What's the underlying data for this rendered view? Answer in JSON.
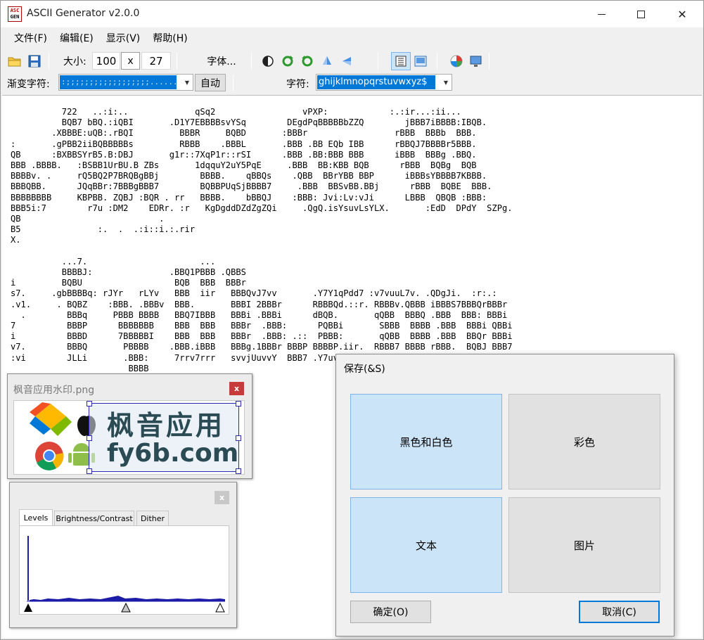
{
  "window": {
    "title": "ASCII Generator v2.0.0",
    "logo_line1": "ASC",
    "logo_line2": "GEN",
    "minimize": "–",
    "maximize": "□",
    "close": "✕"
  },
  "menu": [
    "文件(F)",
    "编辑(E)",
    "显示(V)",
    "帮助(H)"
  ],
  "toolbar": {
    "size_label": "大小:",
    "width": "100",
    "x_label": "x",
    "height": "27",
    "font_button": "字体...",
    "icons": [
      "open-folder-icon",
      "save-disk-icon",
      "invert-icon",
      "rotate-clockwise-icon",
      "rotate-counterclockwise-icon",
      "flip-vertical-icon",
      "flip-horizontal-icon",
      "text-view-icon",
      "image-view-icon",
      "color-palette-icon",
      "preview-monitor-icon"
    ]
  },
  "row2": {
    "ramp_label": "渐变字符:",
    "ramp_value": ":;;;;;;;;;;;;;;;;;;.............",
    "auto_button": "自动",
    "chars_label": "字符:",
    "chars_value": "ghijklmnopqrstuvwxyz$"
  },
  "ascii": "          722   ..:i:..             qSq2                 vPXP:            :.:ir...:ii...\n          BQB7 bBQ.:iQBI       .D1Y7EBBBBsvYSq        DEgdPqBBBBBbZZQ        jBBB7iBBBB:IBQB.\n        .XBBBE:uQB:.rBQI         BBBR     BQBD       :BBBr                 rBBB  BBBb  BBB.\n:       .gPBB2iiBQBBBBBs         RBBB    .BBBL       .BBB .BB EQb IBB      rBBQJ7BBBBr5BBB.\nQB      :BXBBSYrB5.B:DBJ       g1r::7XqP1r::rSI      .BBB .BB:BBB BBB      iBBB  BBBg .BBQ.\nBBB .BBBB.   :BSBB1UrBU.B ZBs       1dqquY2uY5PqE     .BBB  BB:KBB BQB      rBBB  BQBg  BQB\nBBBBv. .     rQ5BQ2P7BRQBgBBj        BBBB.    qBBQs    .QBB  BBrYBB BBP      iBBBsYBBBB7KBBB.\nBBBQBB.      JQqBBr:7BBBgBBB7        BQBBPUqSjBBBB7     .BBB  BBSvBB.BBj      rBBB  BQBE  BBB.\nBBBBBBBB     KBPBB. ZQBJ :BQR . rr   BBBB.    bBBQJ    :BBB: Jvi:Lv:vJi      LBBB  QBQB :BBB:\nBBB5i:7        r7u :DM2    EDRr. :r   KgDgddDZdZgZQi     .QgQ.isYsuvLsYLX.       :EdD  DPdY  SZPg.\nQB                           .\nB5               :.  .  .:i::i.:.rir\nX.\n\n          ...7.                      ...\n          BBBBJ:               .BBQ1PBBB .QBBS\ni         BQBU                  BQB  BBB  BBBr\ns7.     .gbBBBBq: rJYr   rLYv   BBB  iir   BBBQvJ7vv       .Y7Y1qPdd7 :v7vuuL7v. .QDgJi.  :r:.:\n.v1.     . BQBZ    :BBB. .BBBv  BBB.       BBBI 2BBBr      RBBBQd.::r. RBBBv.QBBB iBBBS7BBBQrBBBr\n  .        BBBq     PBBB BBBB   BBQ7IBBB   BBBi .BBBi      dBQB.       qQBB  BBBQ .BBB  BBB: BBBi\n7          BBBP      BBBBBBB    BBB  BBB   BBBr  .BBB:      PQBBi       SBBB  BBBB .BBB  BBBi QBBi\ni          BBBD      7BBBBBI    BBB  BBB   BBBr  .BBB: .::  PBBB:       qQBB  BBBB .BBB  BBQr BBBi\nv7.        BBBQ       PBBBB    .BBB.iBBB   BBBg.1BBBr BBBP BBBBP.iir.  RBBB7 BBBB rBBB.  BQBJ BBB7\n:vi        JLLi       .BBB:     7rrv7rrr   svvjUuvvY  BBB7 .Y7uvYshdr  :Lrrv1Y7Lr  Jvi  Yvi  Jvi\n                       BBBB\n                       ...",
  "preview_window": {
    "title": "枫音应用水印.png",
    "close": "x",
    "watermark_cn": "枫音应用",
    "watermark_en": "fy6b.com",
    "icons": [
      "windows-logo-icon",
      "apple-logo-icon",
      "chrome-logo-icon",
      "android-logo-icon"
    ]
  },
  "levels_window": {
    "close": "x",
    "tabs": [
      "Levels",
      "Brightness/Contrast",
      "Dither"
    ]
  },
  "save_dialog": {
    "title": "保存(&S)",
    "options": [
      "黑色和白色",
      "彩色",
      "文本",
      "图片"
    ],
    "ok": "确定(O)",
    "cancel": "取消(C)"
  }
}
